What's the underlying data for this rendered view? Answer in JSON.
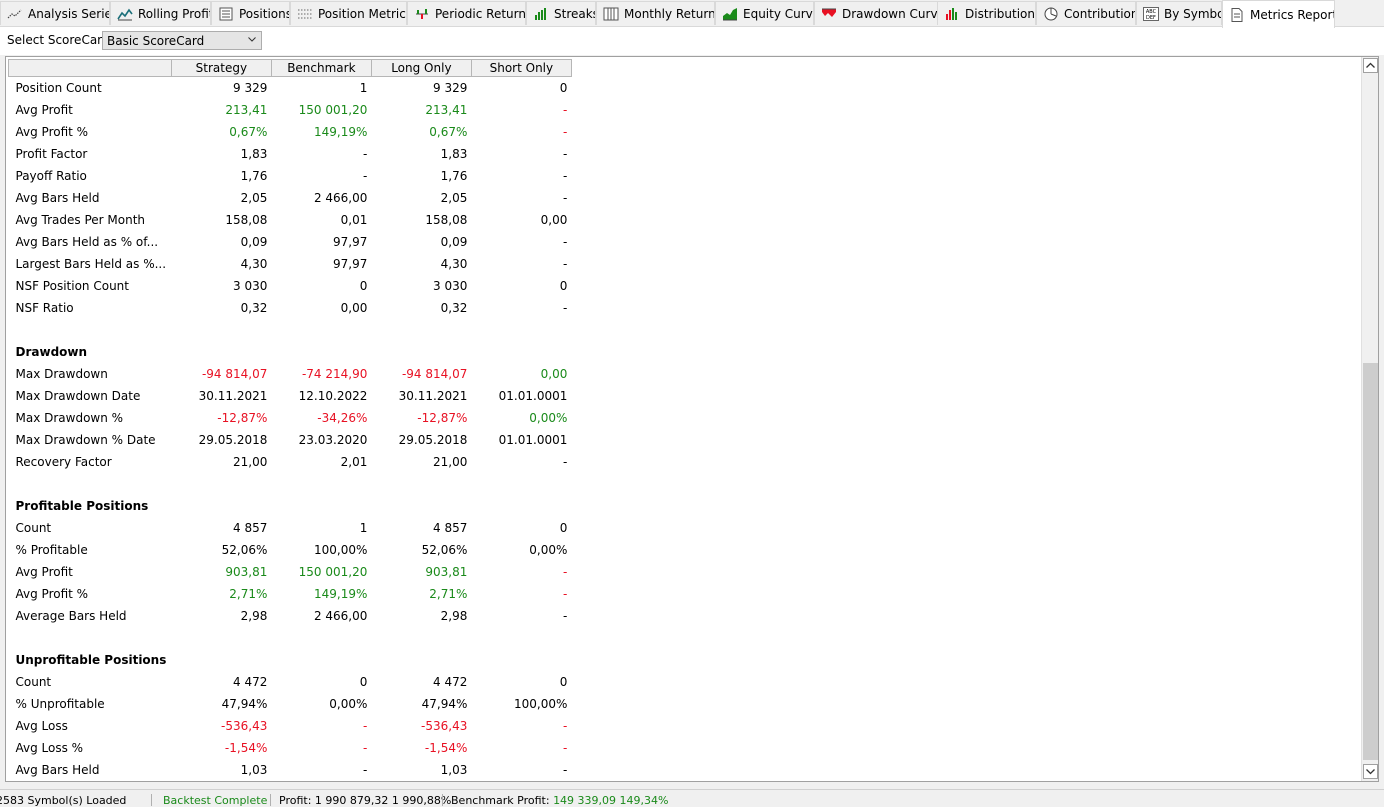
{
  "tabs": [
    {
      "label": "Analysis Series",
      "icon": "analysis-series-icon",
      "active": false
    },
    {
      "label": "Rolling Profit",
      "icon": "rolling-profit-icon",
      "active": false
    },
    {
      "label": "Positions",
      "icon": "positions-icon",
      "active": false
    },
    {
      "label": "Position Metrics",
      "icon": "position-metrics-icon",
      "active": false
    },
    {
      "label": "Periodic Returns",
      "icon": "periodic-returns-icon",
      "active": false
    },
    {
      "label": "Streaks",
      "icon": "streaks-icon",
      "active": false
    },
    {
      "label": "Monthly Returns",
      "icon": "monthly-returns-icon",
      "active": false
    },
    {
      "label": "Equity Curve",
      "icon": "equity-curve-icon",
      "active": false
    },
    {
      "label": "Drawdown Curve",
      "icon": "drawdown-curve-icon",
      "active": false
    },
    {
      "label": "Distributions",
      "icon": "distributions-icon",
      "active": false
    },
    {
      "label": "Contribution",
      "icon": "contribution-icon",
      "active": false
    },
    {
      "label": "By Symbol",
      "icon": "by-symbol-icon",
      "active": false
    },
    {
      "label": "Metrics Report",
      "icon": "metrics-report-icon",
      "active": true
    }
  ],
  "scorecard": {
    "label": "Select ScoreCard:",
    "selected": "Basic ScoreCard"
  },
  "columns": [
    "",
    "Strategy",
    "Benchmark",
    "Long Only",
    "Short Only"
  ],
  "colors": {
    "positive": "#1a8a1a",
    "negative": "#e81123",
    "neutral": "#000000"
  },
  "rows": [
    {
      "label": "Position Count",
      "values": [
        "9 329",
        "1",
        "9 329",
        "0"
      ],
      "tones": [
        "",
        "",
        "",
        ""
      ]
    },
    {
      "label": "Avg Profit",
      "values": [
        "213,41",
        "150 001,20",
        "213,41",
        "-"
      ],
      "tones": [
        "pos",
        "pos",
        "pos",
        "neg"
      ]
    },
    {
      "label": "Avg Profit %",
      "values": [
        "0,67%",
        "149,19%",
        "0,67%",
        "-"
      ],
      "tones": [
        "pos",
        "pos",
        "pos",
        "neg"
      ]
    },
    {
      "label": "Profit Factor",
      "values": [
        "1,83",
        "-",
        "1,83",
        "-"
      ],
      "tones": [
        "",
        "",
        "",
        ""
      ]
    },
    {
      "label": "Payoff Ratio",
      "values": [
        "1,76",
        "-",
        "1,76",
        "-"
      ],
      "tones": [
        "",
        "",
        "",
        ""
      ]
    },
    {
      "label": "Avg Bars Held",
      "values": [
        "2,05",
        "2 466,00",
        "2,05",
        "-"
      ],
      "tones": [
        "",
        "",
        "",
        ""
      ]
    },
    {
      "label": "Avg Trades Per Month",
      "values": [
        "158,08",
        "0,01",
        "158,08",
        "0,00"
      ],
      "tones": [
        "",
        "",
        "",
        ""
      ]
    },
    {
      "label": "Avg Bars Held as % of...",
      "values": [
        "0,09",
        "97,97",
        "0,09",
        "-"
      ],
      "tones": [
        "",
        "",
        "",
        ""
      ]
    },
    {
      "label": "Largest Bars Held as %...",
      "values": [
        "4,30",
        "97,97",
        "4,30",
        "-"
      ],
      "tones": [
        "",
        "",
        "",
        ""
      ]
    },
    {
      "label": "NSF Position Count",
      "values": [
        "3 030",
        "0",
        "3 030",
        "0"
      ],
      "tones": [
        "",
        "",
        "",
        ""
      ]
    },
    {
      "label": "NSF Ratio",
      "values": [
        "0,32",
        "0,00",
        "0,32",
        "-"
      ],
      "tones": [
        "",
        "",
        "",
        ""
      ]
    },
    {
      "label": "",
      "values": [
        "",
        "",
        "",
        ""
      ],
      "tones": [
        "",
        "",
        "",
        ""
      ]
    },
    {
      "label": "Drawdown",
      "values": [
        "",
        "",
        "",
        ""
      ],
      "tones": [
        "",
        "",
        "",
        ""
      ],
      "section": true
    },
    {
      "label": "Max Drawdown",
      "values": [
        "-94 814,07",
        "-74 214,90",
        "-94 814,07",
        "0,00"
      ],
      "tones": [
        "neg",
        "neg",
        "neg",
        "pos"
      ]
    },
    {
      "label": "Max Drawdown Date",
      "values": [
        "30.11.2021",
        "12.10.2022",
        "30.11.2021",
        "01.01.0001"
      ],
      "tones": [
        "",
        "",
        "",
        ""
      ]
    },
    {
      "label": "Max Drawdown %",
      "values": [
        "-12,87%",
        "-34,26%",
        "-12,87%",
        "0,00%"
      ],
      "tones": [
        "neg",
        "neg",
        "neg",
        "pos"
      ]
    },
    {
      "label": "Max Drawdown % Date",
      "values": [
        "29.05.2018",
        "23.03.2020",
        "29.05.2018",
        "01.01.0001"
      ],
      "tones": [
        "",
        "",
        "",
        ""
      ]
    },
    {
      "label": "Recovery Factor",
      "values": [
        "21,00",
        "2,01",
        "21,00",
        "-"
      ],
      "tones": [
        "",
        "",
        "",
        ""
      ]
    },
    {
      "label": "",
      "values": [
        "",
        "",
        "",
        ""
      ],
      "tones": [
        "",
        "",
        "",
        ""
      ]
    },
    {
      "label": "Profitable Positions",
      "values": [
        "",
        "",
        "",
        ""
      ],
      "tones": [
        "",
        "",
        "",
        ""
      ],
      "section": true
    },
    {
      "label": "Count",
      "values": [
        "4 857",
        "1",
        "4 857",
        "0"
      ],
      "tones": [
        "",
        "",
        "",
        ""
      ]
    },
    {
      "label": "% Profitable",
      "values": [
        "52,06%",
        "100,00%",
        "52,06%",
        "0,00%"
      ],
      "tones": [
        "",
        "",
        "",
        ""
      ]
    },
    {
      "label": "Avg Profit",
      "values": [
        "903,81",
        "150 001,20",
        "903,81",
        "-"
      ],
      "tones": [
        "pos",
        "pos",
        "pos",
        "neg"
      ]
    },
    {
      "label": "Avg Profit %",
      "values": [
        "2,71%",
        "149,19%",
        "2,71%",
        "-"
      ],
      "tones": [
        "pos",
        "pos",
        "pos",
        "neg"
      ]
    },
    {
      "label": "Average Bars Held",
      "values": [
        "2,98",
        "2 466,00",
        "2,98",
        "-"
      ],
      "tones": [
        "",
        "",
        "",
        ""
      ]
    },
    {
      "label": "",
      "values": [
        "",
        "",
        "",
        ""
      ],
      "tones": [
        "",
        "",
        "",
        ""
      ]
    },
    {
      "label": "Unprofitable Positions",
      "values": [
        "",
        "",
        "",
        ""
      ],
      "tones": [
        "",
        "",
        "",
        ""
      ],
      "section": true
    },
    {
      "label": "Count",
      "values": [
        "4 472",
        "0",
        "4 472",
        "0"
      ],
      "tones": [
        "",
        "",
        "",
        ""
      ]
    },
    {
      "label": "% Unprofitable",
      "values": [
        "47,94%",
        "0,00%",
        "47,94%",
        "100,00%"
      ],
      "tones": [
        "",
        "",
        "",
        ""
      ]
    },
    {
      "label": "Avg Loss",
      "values": [
        "-536,43",
        "-",
        "-536,43",
        "-"
      ],
      "tones": [
        "neg",
        "neg",
        "neg",
        "neg"
      ]
    },
    {
      "label": "Avg Loss %",
      "values": [
        "-1,54%",
        "-",
        "-1,54%",
        "-"
      ],
      "tones": [
        "neg",
        "neg",
        "neg",
        "neg"
      ]
    },
    {
      "label": "Avg Bars Held",
      "values": [
        "1,03",
        "-",
        "1,03",
        "-"
      ],
      "tones": [
        "",
        "",
        "",
        ""
      ]
    }
  ],
  "status": {
    "symbols": "2583 Symbol(s) Loaded",
    "backtest": "Backtest Complete",
    "profit": "Profit: 1 990 879,32 1 990,88%",
    "benchmark_label": "Benchmark Profit:",
    "benchmark_value": "149 339,09 149,34%"
  }
}
